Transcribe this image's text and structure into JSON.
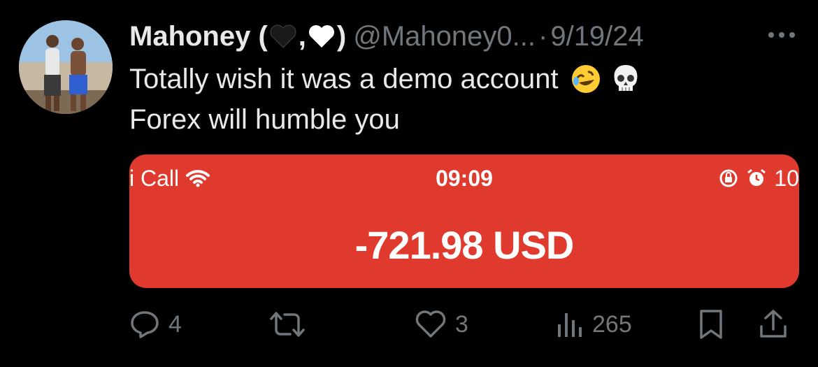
{
  "author": {
    "display_name": "Mahoney (",
    "display_name_sep": ",",
    "display_name_end": ")",
    "handle": "@Mahoney0...",
    "separator": "·",
    "date": "9/19/24"
  },
  "tweet": {
    "line1": "Totally wish it was a demo account",
    "line2": "Forex will humble you",
    "emojis": [
      "rolling-on-floor-laughing",
      "skull"
    ]
  },
  "media": {
    "status_carrier": "i Call",
    "status_time": "09:09",
    "status_battery": "10",
    "amount": "-721.98 USD",
    "background_color": "#e03a2e"
  },
  "actions": {
    "replies": "4",
    "reposts": "",
    "likes": "3",
    "views": "265"
  },
  "colors": {
    "background": "#000000",
    "text": "#e7e9ea",
    "muted": "#71767b"
  }
}
